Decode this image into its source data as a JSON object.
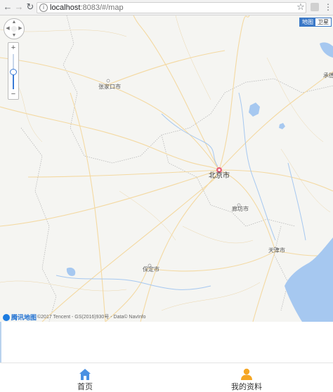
{
  "browser": {
    "url_host": "localhost",
    "url_rest": ":8083/#/map",
    "back_icon": "back-arrow-icon",
    "forward_icon": "forward-arrow-icon",
    "reload_icon": "reload-icon"
  },
  "map": {
    "type_buttons": [
      "地图",
      "卫星"
    ],
    "active_type": "地图",
    "labels": {
      "beijing": "北京市",
      "tianjin": "天津市",
      "zhangjiakou": "张家口市",
      "langfang": "廊坊市",
      "baoding": "保定市",
      "chengde": "承德"
    },
    "zoom": {
      "plus": "+",
      "minus": "−"
    },
    "logo_text": "腾讯地图",
    "copyright": "©2017 Tencent - GS(2016)930号 - Data© NavInfo",
    "colors": {
      "water": "#a6c8f0",
      "roads": "#f4d9a2",
      "land": "#f5f5f2",
      "accent": "#3a78c7"
    }
  },
  "tabs": [
    {
      "label": "首页",
      "icon": "home-icon",
      "color": "#4a90e2"
    },
    {
      "label": "我的资料",
      "icon": "user-icon",
      "color": "#f5a623"
    }
  ]
}
